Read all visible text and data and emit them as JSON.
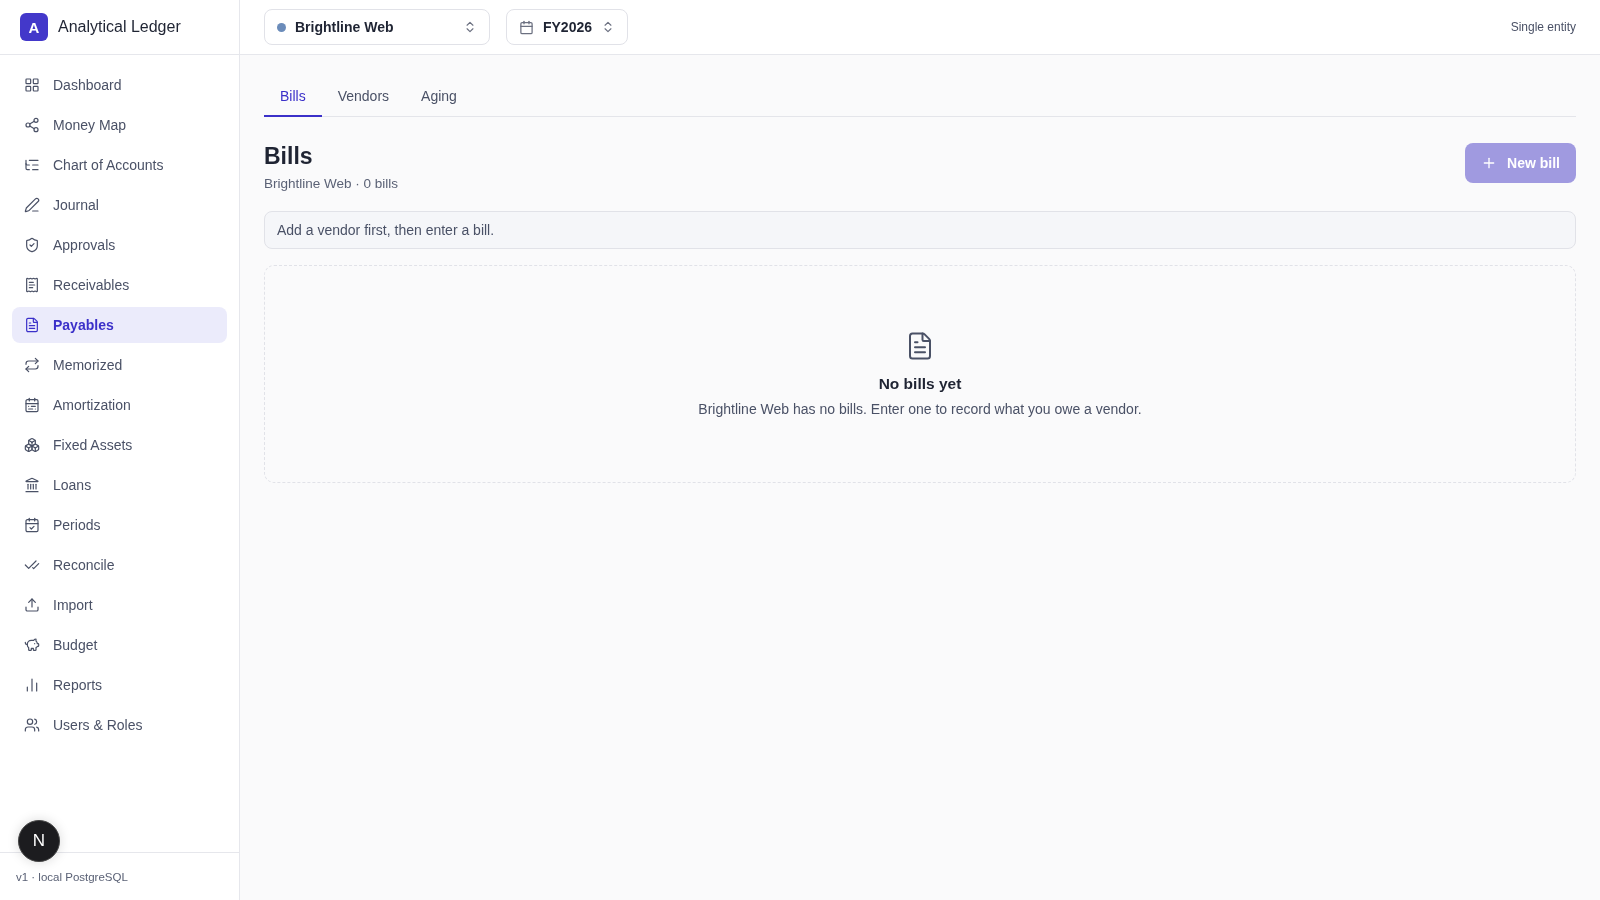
{
  "app": {
    "logo_letter": "A",
    "name": "Analytical Ledger"
  },
  "sidebar": {
    "items": [
      {
        "label": "Dashboard",
        "selected": false
      },
      {
        "label": "Money Map",
        "selected": false
      },
      {
        "label": "Chart of Accounts",
        "selected": false
      },
      {
        "label": "Journal",
        "selected": false
      },
      {
        "label": "Approvals",
        "selected": false
      },
      {
        "label": "Receivables",
        "selected": false
      },
      {
        "label": "Payables",
        "selected": true
      },
      {
        "label": "Memorized",
        "selected": false
      },
      {
        "label": "Amortization",
        "selected": false
      },
      {
        "label": "Fixed Assets",
        "selected": false
      },
      {
        "label": "Loans",
        "selected": false
      },
      {
        "label": "Periods",
        "selected": false
      },
      {
        "label": "Reconcile",
        "selected": false
      },
      {
        "label": "Import",
        "selected": false
      },
      {
        "label": "Budget",
        "selected": false
      },
      {
        "label": "Reports",
        "selected": false
      },
      {
        "label": "Users & Roles",
        "selected": false
      }
    ],
    "footer": "v1 · local PostgreSQL"
  },
  "dev_badge": "N",
  "topbar": {
    "entity": {
      "label": "Brightline Web",
      "color": "#6b8cba"
    },
    "period": "FY2026",
    "mode": "Single entity"
  },
  "tabs": [
    {
      "label": "Bills",
      "selected": true
    },
    {
      "label": "Vendors",
      "selected": false
    },
    {
      "label": "Aging",
      "selected": false
    }
  ],
  "page": {
    "title": "Bills",
    "subtitle": "Brightline Web · 0 bills",
    "new_button": {
      "label": "New bill",
      "disabled": true
    },
    "notice": "Add a vendor first, then enter a bill."
  },
  "empty_state": {
    "title": "No bills yet",
    "text": "Brightline Web has no bills. Enter one to record what you owe a vendor."
  }
}
